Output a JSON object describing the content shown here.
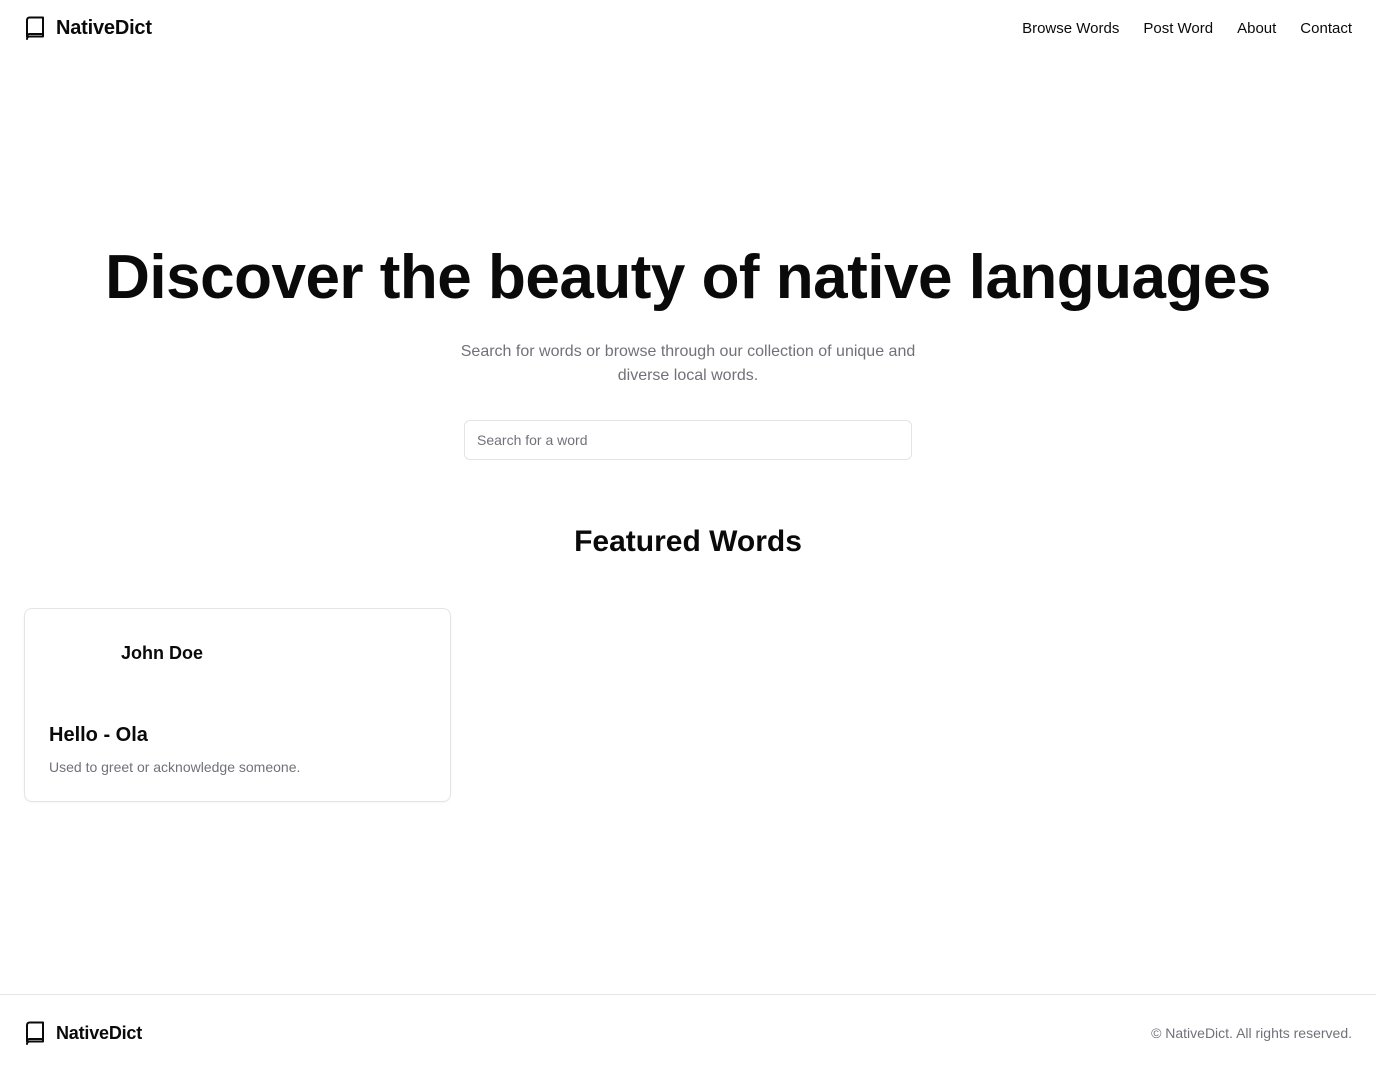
{
  "header": {
    "brand_name": "NativeDict",
    "brand_icon": "book-icon",
    "nav": [
      {
        "label": "Browse Words"
      },
      {
        "label": "Post Word"
      },
      {
        "label": "About"
      },
      {
        "label": "Contact"
      }
    ]
  },
  "hero": {
    "title": "Discover the beauty of native languages",
    "subtitle": "Search for words or browse through our collection of unique and diverse local words.",
    "search_placeholder": "Search for a word",
    "search_value": ""
  },
  "featured": {
    "title": "Featured Words",
    "cards": [
      {
        "author": "John Doe",
        "word": "Hello - Ola",
        "description": "Used to greet or acknowledge someone."
      }
    ]
  },
  "footer": {
    "brand_name": "NativeDict",
    "brand_icon": "book-icon",
    "copyright": "© NativeDict. All rights reserved."
  },
  "colors": {
    "text": "#0a0a0a",
    "muted": "#71717a",
    "border": "#e4e4e7",
    "background": "#ffffff"
  }
}
